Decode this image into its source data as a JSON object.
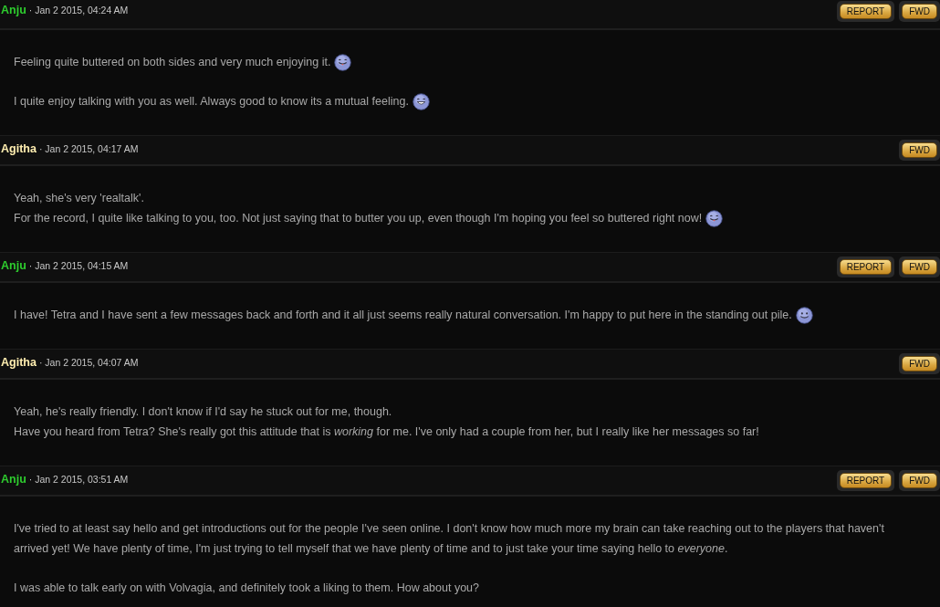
{
  "posts": [
    {
      "author": "Anju",
      "color": "#2ecc2e",
      "date": "· Jan 2 2015, 04:24 AM",
      "buttons": [
        "REPORT",
        "FWD"
      ],
      "paragraphs": [
        {
          "lines": [
            {
              "text": "Feeling quite buttered on both sides and very much enjoying it.",
              "kind": "tongue"
            }
          ]
        },
        {
          "lines": [
            {
              "text": "I quite enjoy talking with you as well. Always good to know its a mutual feeling.",
              "kind": "grin"
            }
          ]
        }
      ]
    },
    {
      "author": "Agitha",
      "color": "#ffeeb0",
      "date": "· Jan 2 2015, 04:17 AM",
      "buttons": [
        "FWD"
      ],
      "paragraphs": [
        {
          "lines": [
            {
              "text": "Yeah, she's very 'realtalk'.",
              "kind": "plain"
            },
            {
              "text": "For the record, I quite like talking to you, too. Not just saying that to butter you up, even though I'm hoping you feel so buttered right now!",
              "kind": "tongue"
            }
          ]
        }
      ]
    },
    {
      "author": "Anju",
      "color": "#2ecc2e",
      "date": "· Jan 2 2015, 04:15 AM",
      "buttons": [
        "REPORT",
        "FWD"
      ],
      "paragraphs": [
        {
          "lines": [
            {
              "text": "I have! Tetra and I have sent a few messages back and forth and it all just seems really natural conversation. I'm happy to put here in the standing out pile.",
              "kind": "smile"
            }
          ]
        }
      ]
    },
    {
      "author": "Agitha",
      "color": "#ffeeb0",
      "date": "· Jan 2 2015, 04:07 AM",
      "buttons": [
        "FWD"
      ],
      "paragraphs": [
        {
          "lines": [
            {
              "text": "Yeah, he's really friendly. I don't know if I'd say he stuck out for me, though.",
              "kind": "plain"
            },
            {
              "text": "Have you heard from Tetra? She's really got this attitude that is *working* for me. I've only had a couple from her, but I really like her messages so far!",
              "kind": "plain"
            }
          ]
        }
      ]
    },
    {
      "author": "Anju",
      "color": "#2ecc2e",
      "date": "· Jan 2 2015, 03:51 AM",
      "buttons": [
        "REPORT",
        "FWD"
      ],
      "paragraphs": [
        {
          "lines": [
            {
              "text": "I've tried to at least say hello and get introductions out for the people I've seen online. I don't know how much more my brain can take reaching out to the players that haven't",
              "kind": "plain"
            },
            {
              "text": "arrived yet! We have plenty of time, I'm just trying to tell myself that we have plenty of time and to just take your time saying hello to *everyone*.",
              "kind": "plain"
            }
          ]
        },
        {
          "lines": [
            {
              "text": "I was able to talk early on with Volvagia, and definitely took a liking to them. How about you?",
              "kind": "plain"
            }
          ]
        }
      ]
    }
  ]
}
